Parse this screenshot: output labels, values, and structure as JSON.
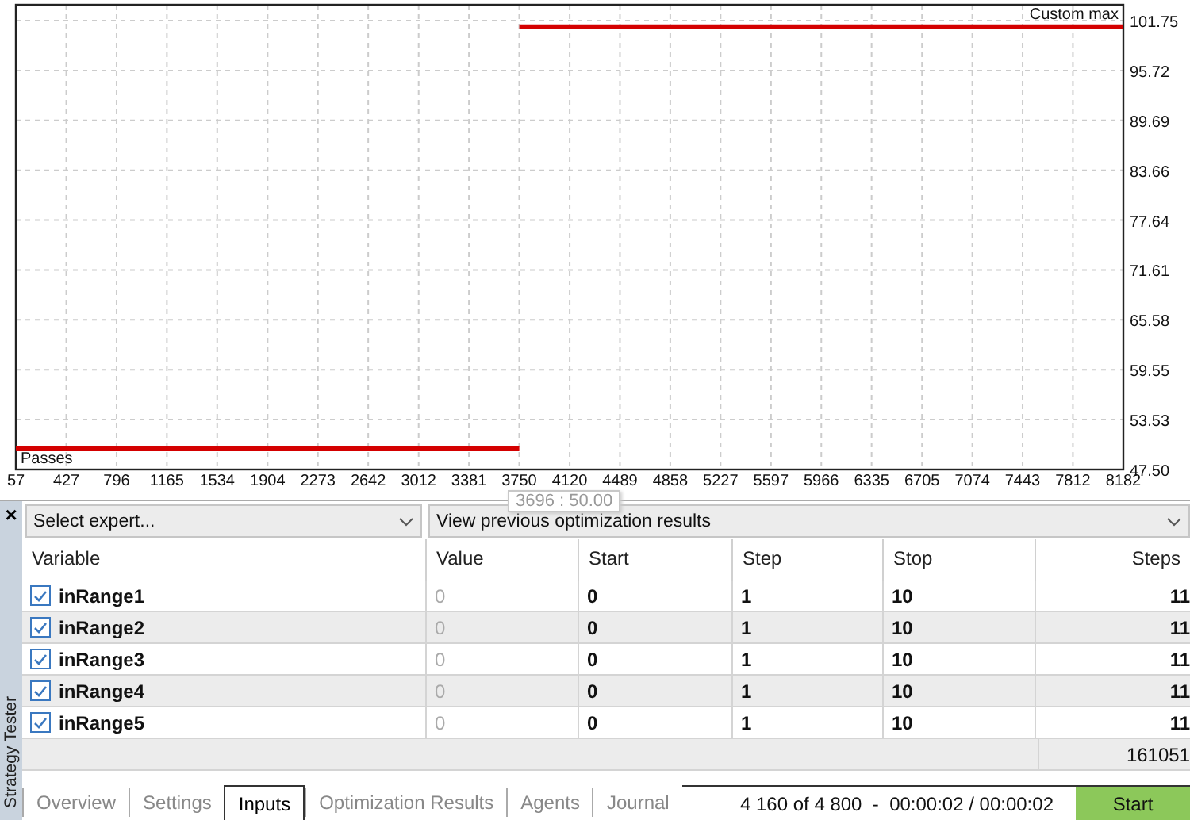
{
  "chart": {
    "chart_data": {
      "type": "line",
      "xlabel": "Passes",
      "ylabel": "Custom max",
      "grid": true,
      "x": [
        57,
        3750,
        3750,
        8182
      ],
      "series": [
        {
          "color": "#d40000",
          "values": [
            50,
            50,
            null,
            null
          ]
        },
        {
          "color": "#d40000",
          "values": [
            null,
            null,
            101,
            101
          ]
        }
      ],
      "xlim": [
        57,
        8182
      ],
      "ylim": [
        47.5,
        101.75
      ],
      "xticks": [
        57,
        427,
        796,
        1165,
        1534,
        1904,
        2273,
        2642,
        3012,
        3381,
        3750,
        4120,
        4489,
        4858,
        5227,
        5597,
        5966,
        6335,
        6705,
        7074,
        7443,
        7812,
        8182
      ],
      "yticks": [
        {
          "value": 47.5,
          "label": "47.50"
        },
        {
          "value": 53.53,
          "label": "53.53"
        },
        {
          "value": 59.55,
          "label": "59.55"
        },
        {
          "value": 65.58,
          "label": "65.58"
        },
        {
          "value": 71.61,
          "label": "71.61"
        },
        {
          "value": 77.64,
          "label": "77.64"
        },
        {
          "value": 83.66,
          "label": "83.66"
        },
        {
          "value": 89.69,
          "label": "89.69"
        },
        {
          "value": 95.72,
          "label": "95.72"
        },
        {
          "value": 101.75,
          "label": "101.75"
        }
      ]
    },
    "tooltip": "3696 : 50.00"
  },
  "panel": {
    "close": "×",
    "title": "Strategy Tester"
  },
  "toolbar": {
    "expert": "Select expert...",
    "results": "View previous optimization results"
  },
  "table": {
    "columns": [
      "Variable",
      "Value",
      "Start",
      "Step",
      "Stop",
      "Steps"
    ],
    "rows": [
      {
        "checked": true,
        "variable": "inRange1",
        "value": "0",
        "start": "0",
        "step": "1",
        "stop": "10",
        "steps": "11"
      },
      {
        "checked": true,
        "variable": "inRange2",
        "value": "0",
        "start": "0",
        "step": "1",
        "stop": "10",
        "steps": "11"
      },
      {
        "checked": true,
        "variable": "inRange3",
        "value": "0",
        "start": "0",
        "step": "1",
        "stop": "10",
        "steps": "11"
      },
      {
        "checked": true,
        "variable": "inRange4",
        "value": "0",
        "start": "0",
        "step": "1",
        "stop": "10",
        "steps": "11"
      },
      {
        "checked": true,
        "variable": "inRange5",
        "value": "0",
        "start": "0",
        "step": "1",
        "stop": "10",
        "steps": "11"
      }
    ],
    "total": "161051"
  },
  "tabs": [
    {
      "label": "Overview",
      "selected": false
    },
    {
      "label": "Settings",
      "selected": false
    },
    {
      "label": "Inputs",
      "selected": true
    },
    {
      "label": "Optimization Results",
      "selected": false
    },
    {
      "label": "Agents",
      "selected": false
    },
    {
      "label": "Journal",
      "selected": false
    }
  ],
  "status": "4 160 of 4 800  -  00:00:02 / 00:00:02",
  "start_button": "Start"
}
